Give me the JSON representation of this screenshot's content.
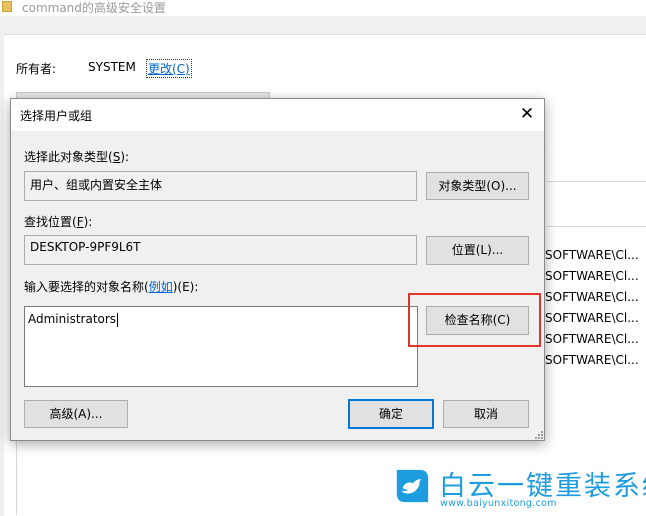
{
  "background_window": {
    "title": "command的高级安全设置",
    "owner_label": "所有者:",
    "owner_value": "SYSTEM",
    "change_link": "更改(C)",
    "partial_dot": "。",
    "list_rows": [
      "\\SOFTWARE\\Cl...",
      "\\SOFTWARE\\Cl...",
      "\\SOFTWARE\\Cl...",
      "\\SOFTWARE\\Cl...",
      "\\SOFTWARE\\Cl...",
      "\\SOFTWARE\\Cl..."
    ]
  },
  "dialog": {
    "title": "选择用户或组",
    "close_glyph": "✕",
    "object_type_label_pre": "选择此对象类型(",
    "object_type_label_key": "S",
    "object_type_label_post": "):",
    "object_type_value": "用户、组或内置安全主体",
    "object_type_button": "对象类型(O)...",
    "location_label_pre": "查找位置(",
    "location_label_key": "F",
    "location_label_post": "):",
    "location_value": "DESKTOP-9PF9L6T",
    "location_button": "位置(L)...",
    "names_label_pre": "输入要选择的对象名称(",
    "names_label_link": "例如",
    "names_label_post": ")(E):",
    "names_value": "Administrators",
    "check_names_button": "检查名称(C)",
    "advanced_button": "高级(A)...",
    "ok_button": "确定",
    "cancel_button": "取消"
  },
  "watermark": {
    "brand": "白云一键重装系统",
    "url": "www.baiyunxitong.com",
    "color": "#1e9ce0"
  },
  "colors": {
    "highlight": "#e0352b",
    "link": "#0066cc",
    "focus": "#0078d7"
  }
}
